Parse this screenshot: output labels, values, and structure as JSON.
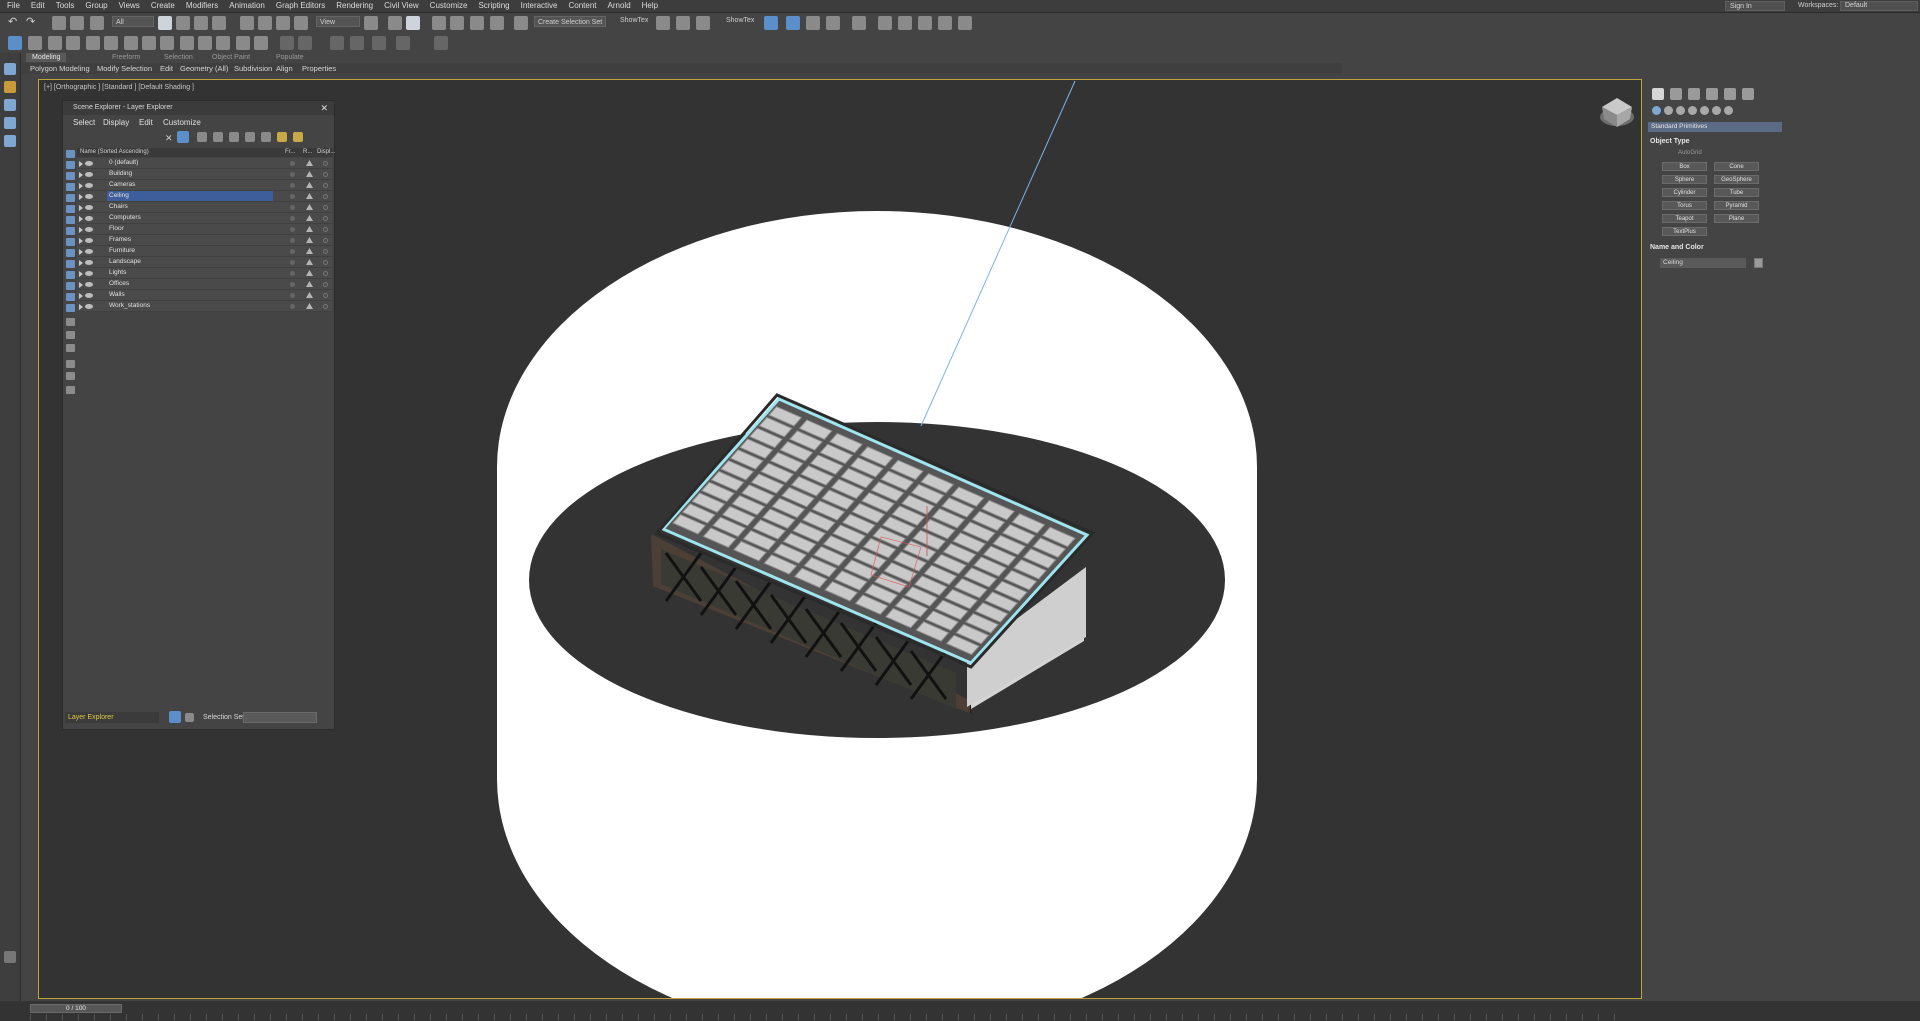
{
  "menubar": {
    "items": [
      "File",
      "Edit",
      "Tools",
      "Group",
      "Views",
      "Create",
      "Modifiers",
      "Animation",
      "Graph Editors",
      "Rendering",
      "Civil View",
      "Customize",
      "Scripting",
      "Interactive",
      "Content",
      "Arnold",
      "Help"
    ],
    "signin": "Sign In",
    "workspaces_label": "Workspaces:",
    "workspace_value": "Default"
  },
  "toolbar": {
    "filter": "All",
    "refcoord": "View",
    "selection_set": "Create Selection Set",
    "showtex1": "ShowTex",
    "showtex2": "ShowTex"
  },
  "ribbon": {
    "tabs": [
      "Modeling",
      "Freeform",
      "Selection",
      "Object Paint",
      "Populate"
    ],
    "subtabs": [
      "Polygon Modeling",
      "Modify Selection",
      "Edit",
      "Geometry (All)",
      "Subdivision",
      "Align",
      "Properties"
    ]
  },
  "viewport": {
    "label": "[+] [Orthographic ] [Standard ] [Default Shading ]"
  },
  "explorer": {
    "title": "Scene Explorer - Layer Explorer",
    "menu": [
      "Select",
      "Display",
      "Edit",
      "Customize"
    ],
    "column_name": "Name (Sorted Ascending)",
    "col_fr": "Fr...",
    "col_r": "R...",
    "col_displ": "Displ...",
    "layers": [
      "0 (default)",
      "Building",
      "Cameras",
      "Ceiling",
      "Chairs",
      "Computers",
      "Floor",
      "Frames",
      "Furniture",
      "Landscape",
      "Lights",
      "Offices",
      "Walls",
      "Work_stations"
    ],
    "selected": "Ceiling",
    "footer_dropdown": "Layer Explorer",
    "selection_set_label": "Selection Set:"
  },
  "command_panel": {
    "dropdown": "Standard Primitives",
    "object_type_title": "Object Type",
    "autogrid": "AutoGrid",
    "buttons": [
      "Box",
      "Cone",
      "Sphere",
      "GeoSphere",
      "Cylinder",
      "Tube",
      "Torus",
      "Pyramid",
      "Teapot",
      "Plane",
      "TextPlus"
    ],
    "name_color_title": "Name and Color",
    "object_name": "Ceiling"
  },
  "timeline": {
    "frame": "0 / 100"
  },
  "colors": {
    "accent": "#3e5d9b",
    "viewport_bg": "#333333",
    "frame_border": "#c0a43a",
    "selection_wire": "#9fe4ef"
  }
}
